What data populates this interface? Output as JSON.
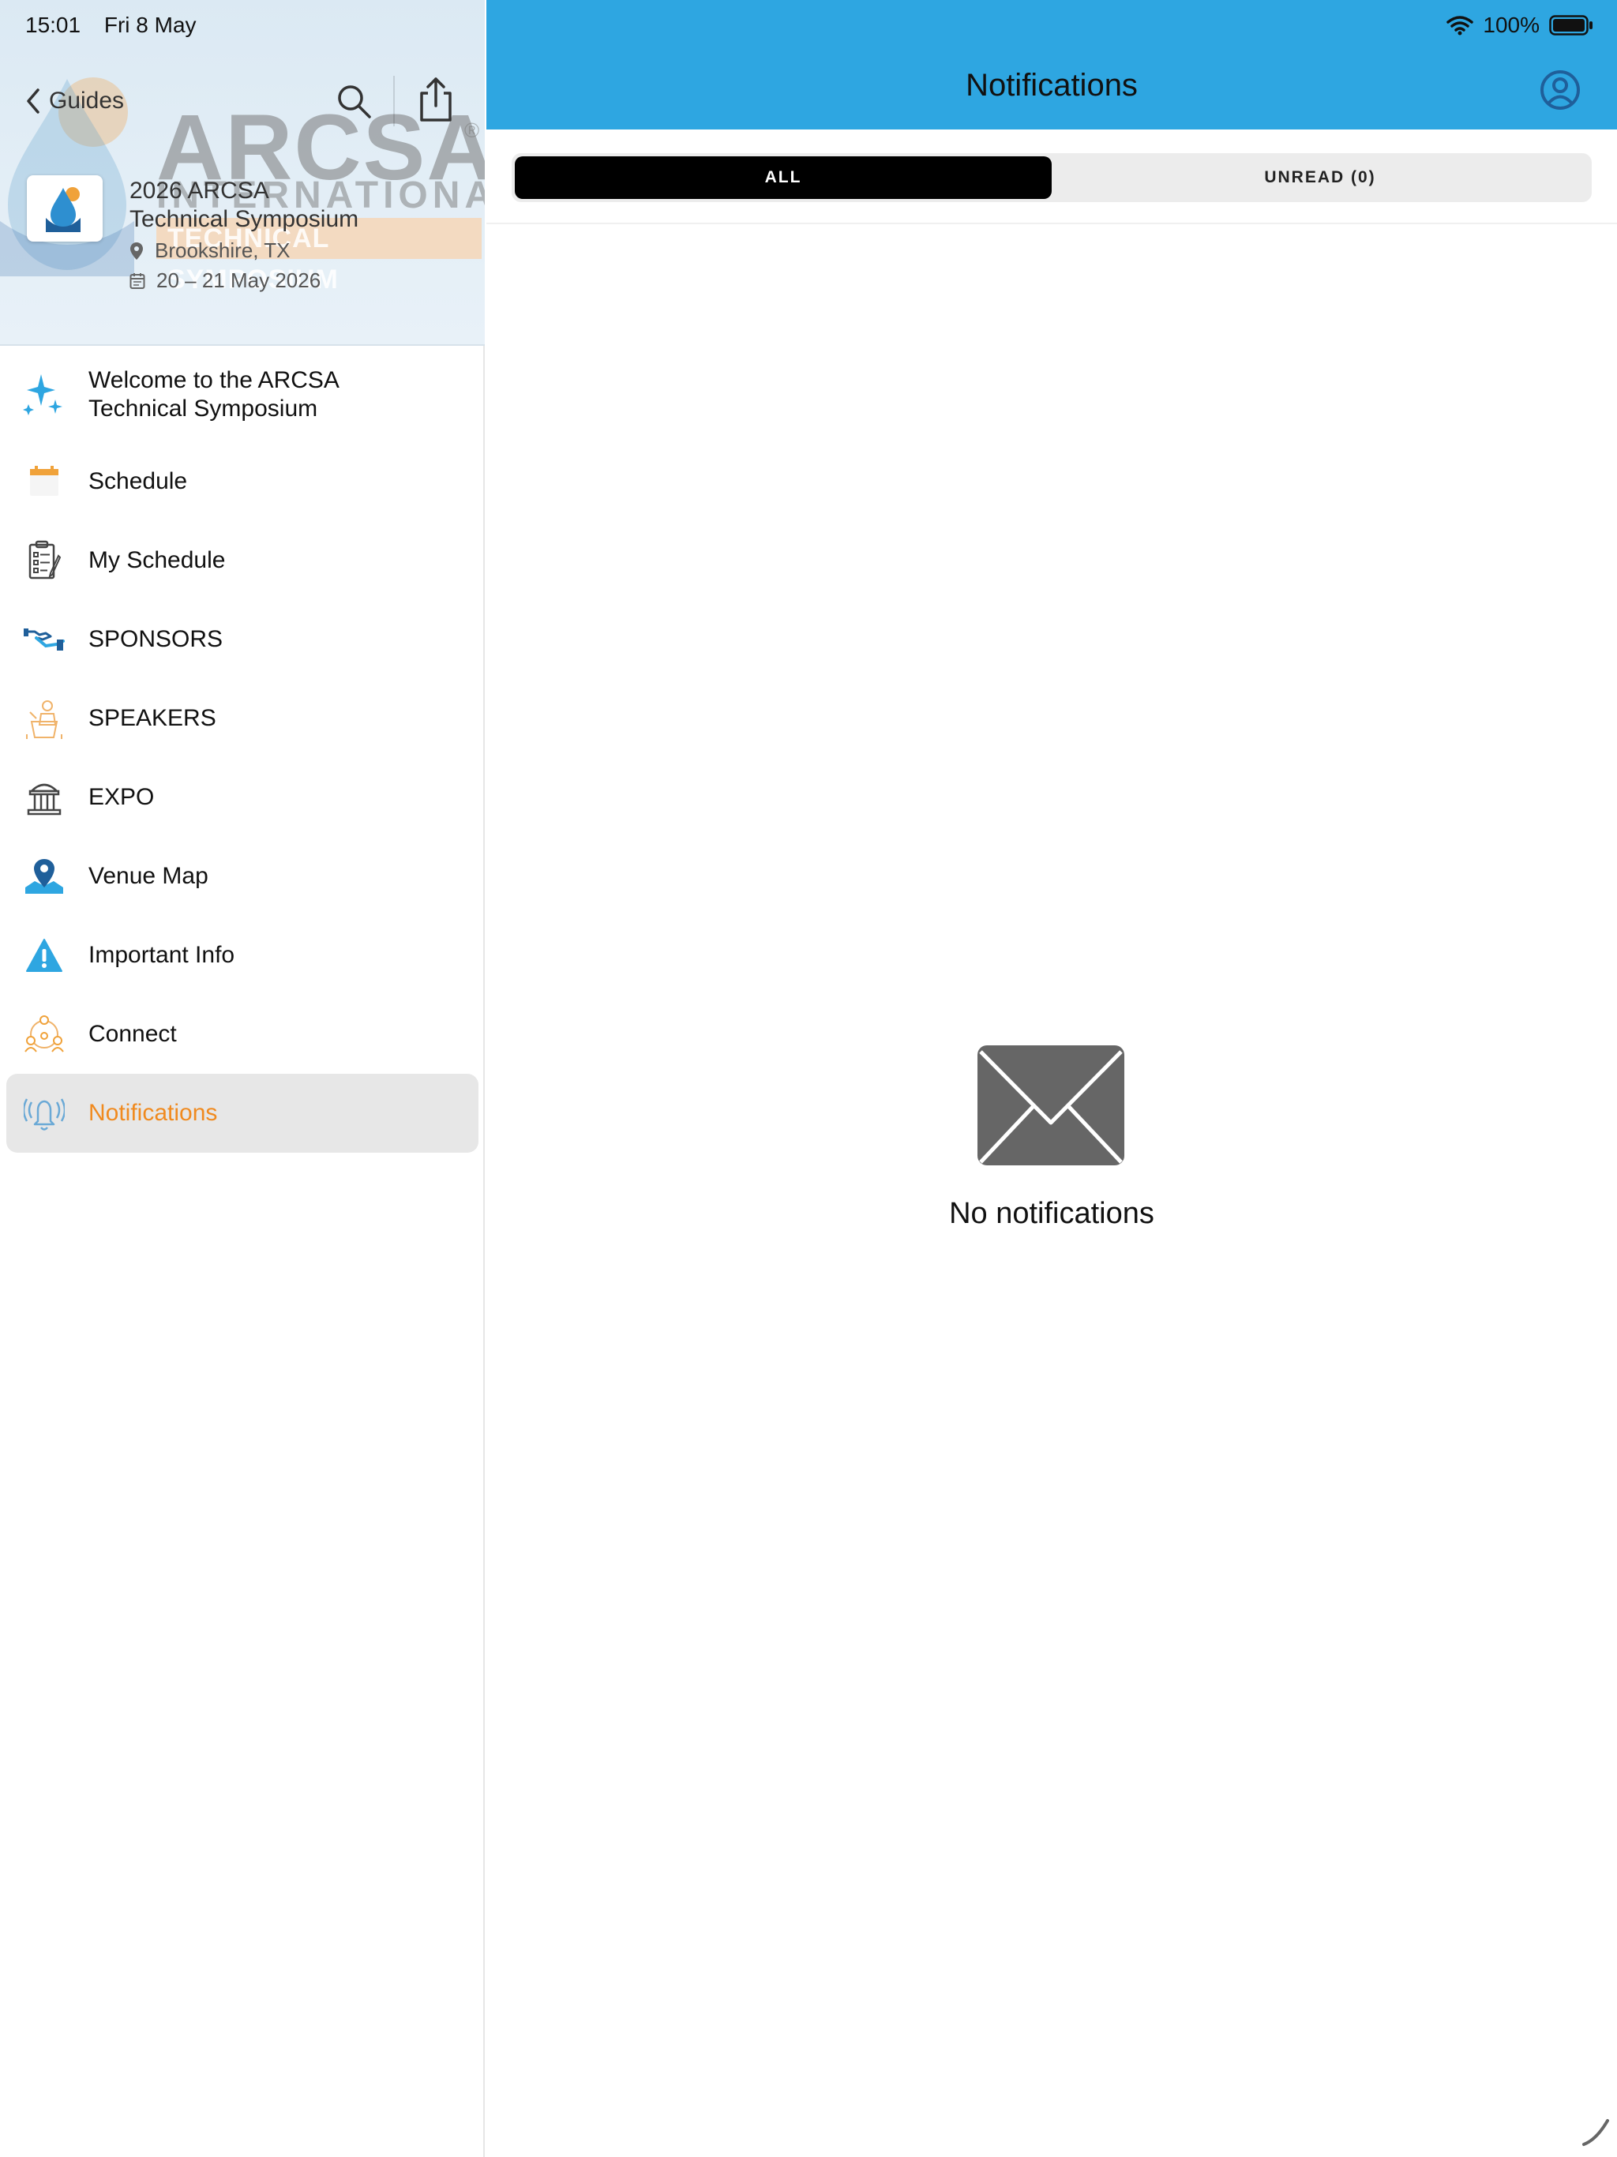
{
  "status": {
    "time": "15:01",
    "date": "Fri 8 May",
    "battery": "100%"
  },
  "sidebar": {
    "back_label": "Guides",
    "banner": {
      "brand": "ARCSA",
      "reg": "®",
      "line2": "INTERNATIONAL",
      "line3": "TECHNICAL SYMPOSIUM"
    },
    "event": {
      "title_line1": "2026 ARCSA",
      "title_line2": "Technical Symposium",
      "location": "Brookshire, TX",
      "dates": "20 – 21 May 2026"
    },
    "items": [
      {
        "label_line1": "Welcome to the ARCSA",
        "label_line2": "Technical Symposium",
        "icon": "sparkles-icon"
      },
      {
        "label": "Schedule",
        "icon": "calendar-icon"
      },
      {
        "label": "My Schedule",
        "icon": "checklist-icon"
      },
      {
        "label": "SPONSORS",
        "icon": "handshake-icon"
      },
      {
        "label": "SPEAKERS",
        "icon": "speaker-icon"
      },
      {
        "label": "EXPO",
        "icon": "building-icon"
      },
      {
        "label": "Venue Map",
        "icon": "map-pin-icon"
      },
      {
        "label": "Important Info",
        "icon": "warning-icon"
      },
      {
        "label": "Connect",
        "icon": "people-network-icon"
      },
      {
        "label": "Notifications",
        "icon": "bell-icon",
        "active": true
      }
    ]
  },
  "main": {
    "title": "Notifications",
    "tabs": [
      {
        "label": "ALL",
        "active": true
      },
      {
        "label": "UNREAD (0)",
        "active": false
      }
    ],
    "empty_message": "No notifications"
  },
  "colors": {
    "topbar": "#2ea6e1",
    "accent_orange": "#f08a1f",
    "profile_icon": "#1f5f9a",
    "envelope": "#666666"
  }
}
